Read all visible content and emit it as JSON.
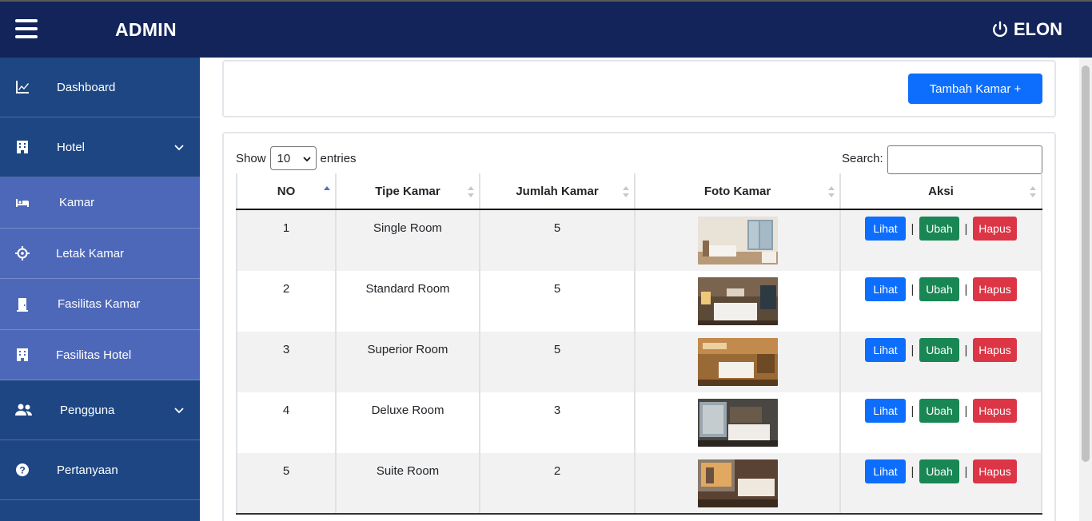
{
  "header": {
    "brand": "ADMIN",
    "user": "ELON"
  },
  "sidebar": {
    "items": [
      {
        "label": "Dashboard",
        "icon": "chart-line-icon",
        "submenu": false
      },
      {
        "label": "Hotel",
        "icon": "building-icon",
        "submenu": true,
        "expanded": true
      },
      {
        "label": "Kamar",
        "icon": "bed-icon",
        "sub": true
      },
      {
        "label": "Letak Kamar",
        "icon": "crosshairs-icon",
        "sub": true
      },
      {
        "label": "Fasilitas Kamar",
        "icon": "door-icon",
        "sub": true
      },
      {
        "label": "Fasilitas Hotel",
        "icon": "building-icon",
        "sub": true
      },
      {
        "label": "Pengguna",
        "icon": "users-icon",
        "submenu": true
      },
      {
        "label": "Pertanyaan",
        "icon": "question-circle-icon",
        "submenu": false
      }
    ]
  },
  "toolbar": {
    "add_label": "Tambah Kamar +"
  },
  "datatable": {
    "show_label": "Show",
    "entries_value": "10",
    "entries_label": "entries",
    "search_label": "Search:",
    "search_value": ""
  },
  "table": {
    "columns": [
      "NO",
      "Tipe Kamar",
      "Jumlah Kamar",
      "Foto Kamar",
      "Aksi"
    ],
    "rows": [
      {
        "no": "1",
        "tipe": "Single Room",
        "jumlah": "5"
      },
      {
        "no": "2",
        "tipe": "Standard Room",
        "jumlah": "5"
      },
      {
        "no": "3",
        "tipe": "Superior Room",
        "jumlah": "5"
      },
      {
        "no": "4",
        "tipe": "Deluxe Room",
        "jumlah": "3"
      },
      {
        "no": "5",
        "tipe": "Suite Room",
        "jumlah": "2"
      }
    ],
    "actions": {
      "view": "Lihat",
      "edit": "Ubah",
      "delete": "Hapus",
      "separator": "|"
    }
  },
  "colors": {
    "topbar": "#13245a",
    "sidebar": "#1d4683",
    "sidebar_sub": "#4d68b8",
    "primary": "#0d6efd",
    "success": "#198754",
    "danger": "#dc3545"
  }
}
